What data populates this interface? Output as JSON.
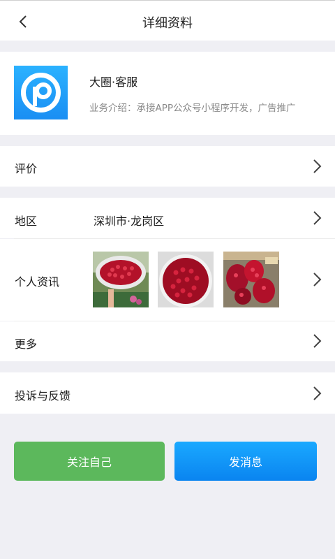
{
  "header": {
    "title": "详细资料",
    "back_icon": "chevron-left-icon"
  },
  "profile": {
    "name": "大圈·客服",
    "description": "业务介绍：承接APP公众号小程序开发，广告推广",
    "logo_colors": {
      "bg": "#1a8ef3",
      "mark": "#ffffff"
    }
  },
  "rows": {
    "review": {
      "label": "评价"
    },
    "region": {
      "label": "地区",
      "value": "深圳市·龙岗区"
    },
    "news": {
      "label": "个人资讯",
      "thumbnails": [
        "pomegranate-photo-1",
        "pomegranate-photo-2",
        "pomegranate-photo-3"
      ]
    },
    "more": {
      "label": "更多"
    },
    "complaint": {
      "label": "投诉与反馈"
    }
  },
  "buttons": {
    "follow": {
      "label": "关注自己",
      "color": "#5cb85c"
    },
    "message": {
      "label": "发消息",
      "color": "#0a84f0"
    }
  }
}
